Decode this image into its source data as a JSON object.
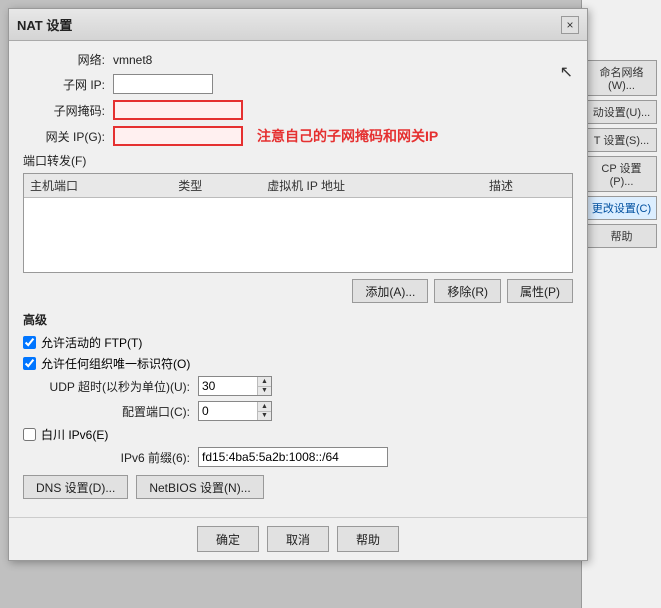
{
  "dialog": {
    "title": "NAT 设置",
    "close_label": "×"
  },
  "form": {
    "network_label": "网络:",
    "network_value": "vmnet8",
    "subnet_ip_label": "子网 IP:",
    "subnet_ip_value": "",
    "subnet_mask_label": "子网掩码:",
    "subnet_mask_value": "",
    "gateway_label": "网关 IP(G):",
    "gateway_value": "",
    "annotation": "注意自己的子网掩码和网关IP"
  },
  "port_forwarding": {
    "label": "端口转发(F)",
    "columns": [
      "主机端口",
      "类型",
      "虚拟机 IP 地址",
      "描述"
    ],
    "rows": [],
    "add_btn": "添加(A)...",
    "remove_btn": "移除(R)",
    "props_btn": "属性(P)"
  },
  "advanced": {
    "label": "高级",
    "ftp_label": "允许活动的 FTP(T)",
    "ftp_checked": true,
    "uuid_label": "允许任何组织唯一标识符(O)",
    "uuid_checked": true,
    "udp_label": "UDP 超时(以秒为单位)(U):",
    "udp_value": "30",
    "config_port_label": "配置端口(C):",
    "config_port_value": "0",
    "ipv6_label": "白川 IPv6(E)",
    "ipv6_checked": false,
    "ipv6_prefix_label": "IPv6 前缀(6):",
    "ipv6_prefix_value": "fd15:4ba5:5a2b:1008::/64",
    "dns_btn": "DNS 设置(D)...",
    "netbios_btn": "NetBIOS 设置(N)..."
  },
  "footer": {
    "ok_label": "确定",
    "cancel_label": "取消",
    "help_label": "帮助"
  },
  "bg_panel": {
    "buttons": [
      "命名网络(W)...",
      "动设置(U)...",
      "T 设置(S)...",
      "CP 设置(P)...",
      "更改设置(C)",
      "帮助"
    ]
  }
}
